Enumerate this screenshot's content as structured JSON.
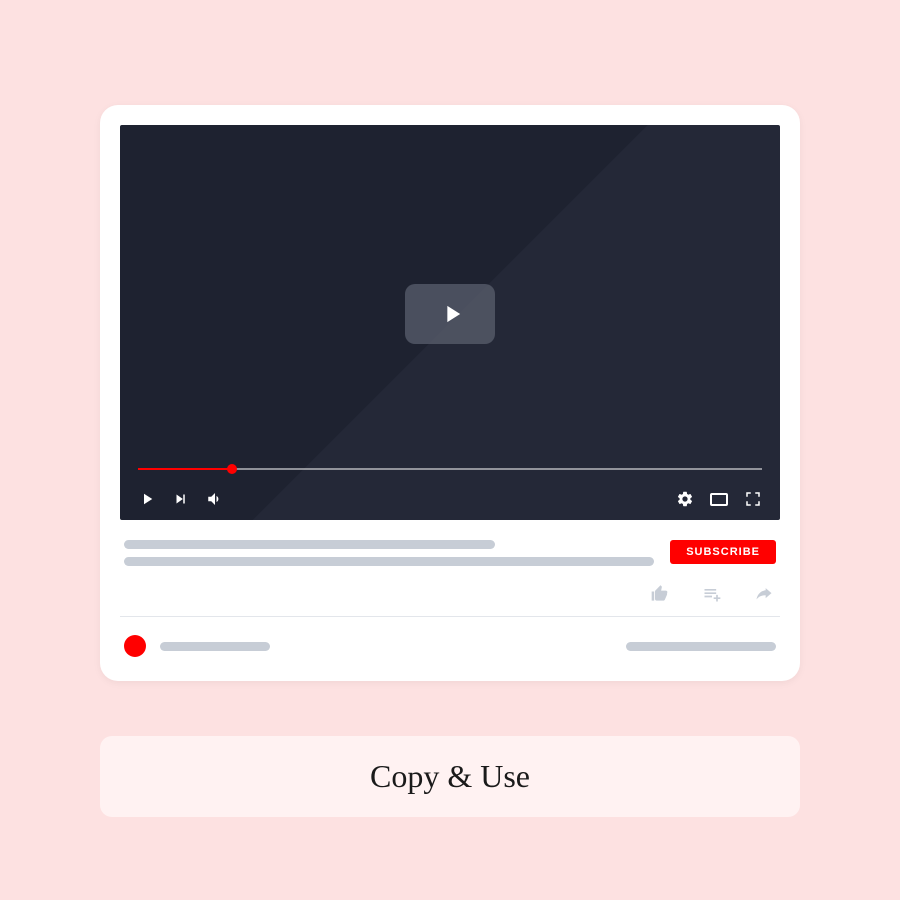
{
  "player": {
    "progress_percent": 15,
    "subscribe_label": "SUBSCRIBE"
  },
  "icons": {
    "play_center": "play-icon",
    "play_small": "play-icon",
    "next": "next-icon",
    "volume": "volume-icon",
    "settings": "gear-icon",
    "theater": "theater-icon",
    "fullscreen": "fullscreen-icon",
    "like": "thumbs-up-icon",
    "playlist_add": "playlist-add-icon",
    "share": "share-icon"
  },
  "colors": {
    "background": "#fde1e1",
    "accent": "#ff0000",
    "video_bg": "#1e2230",
    "placeholder": "#c7cdd6"
  },
  "caption": {
    "label": "Copy & Use"
  }
}
